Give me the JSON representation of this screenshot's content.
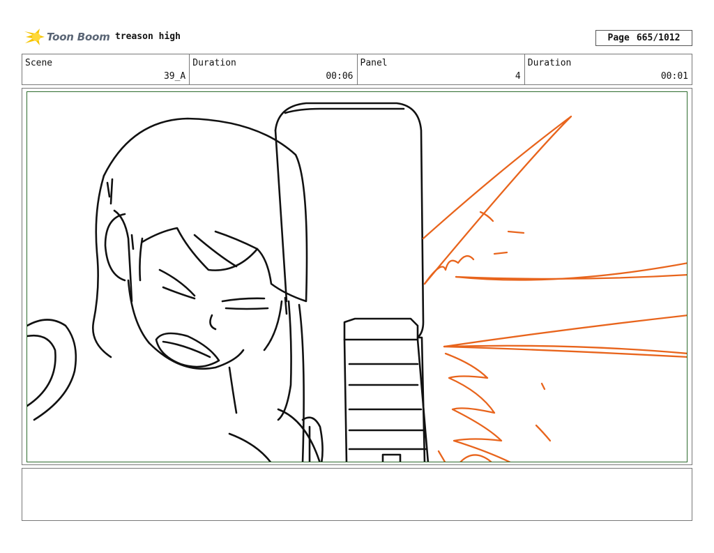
{
  "header": {
    "logo_text": "Toon Boom",
    "project_title": "treason high",
    "page_label": "Page",
    "page_value": "665/1012"
  },
  "info": {
    "scene_label": "Scene",
    "scene_value": "39_A",
    "duration_label": "Duration",
    "duration_value": "00:06",
    "panel_label": "Panel",
    "panel_value": "4",
    "panel_duration_label": "Duration",
    "panel_duration_value": "00:01"
  },
  "notes": {
    "text": ""
  },
  "colors": {
    "frame_border": "#2d6b2d",
    "line_art": "#111111",
    "effect_orange": "#e8641c"
  }
}
